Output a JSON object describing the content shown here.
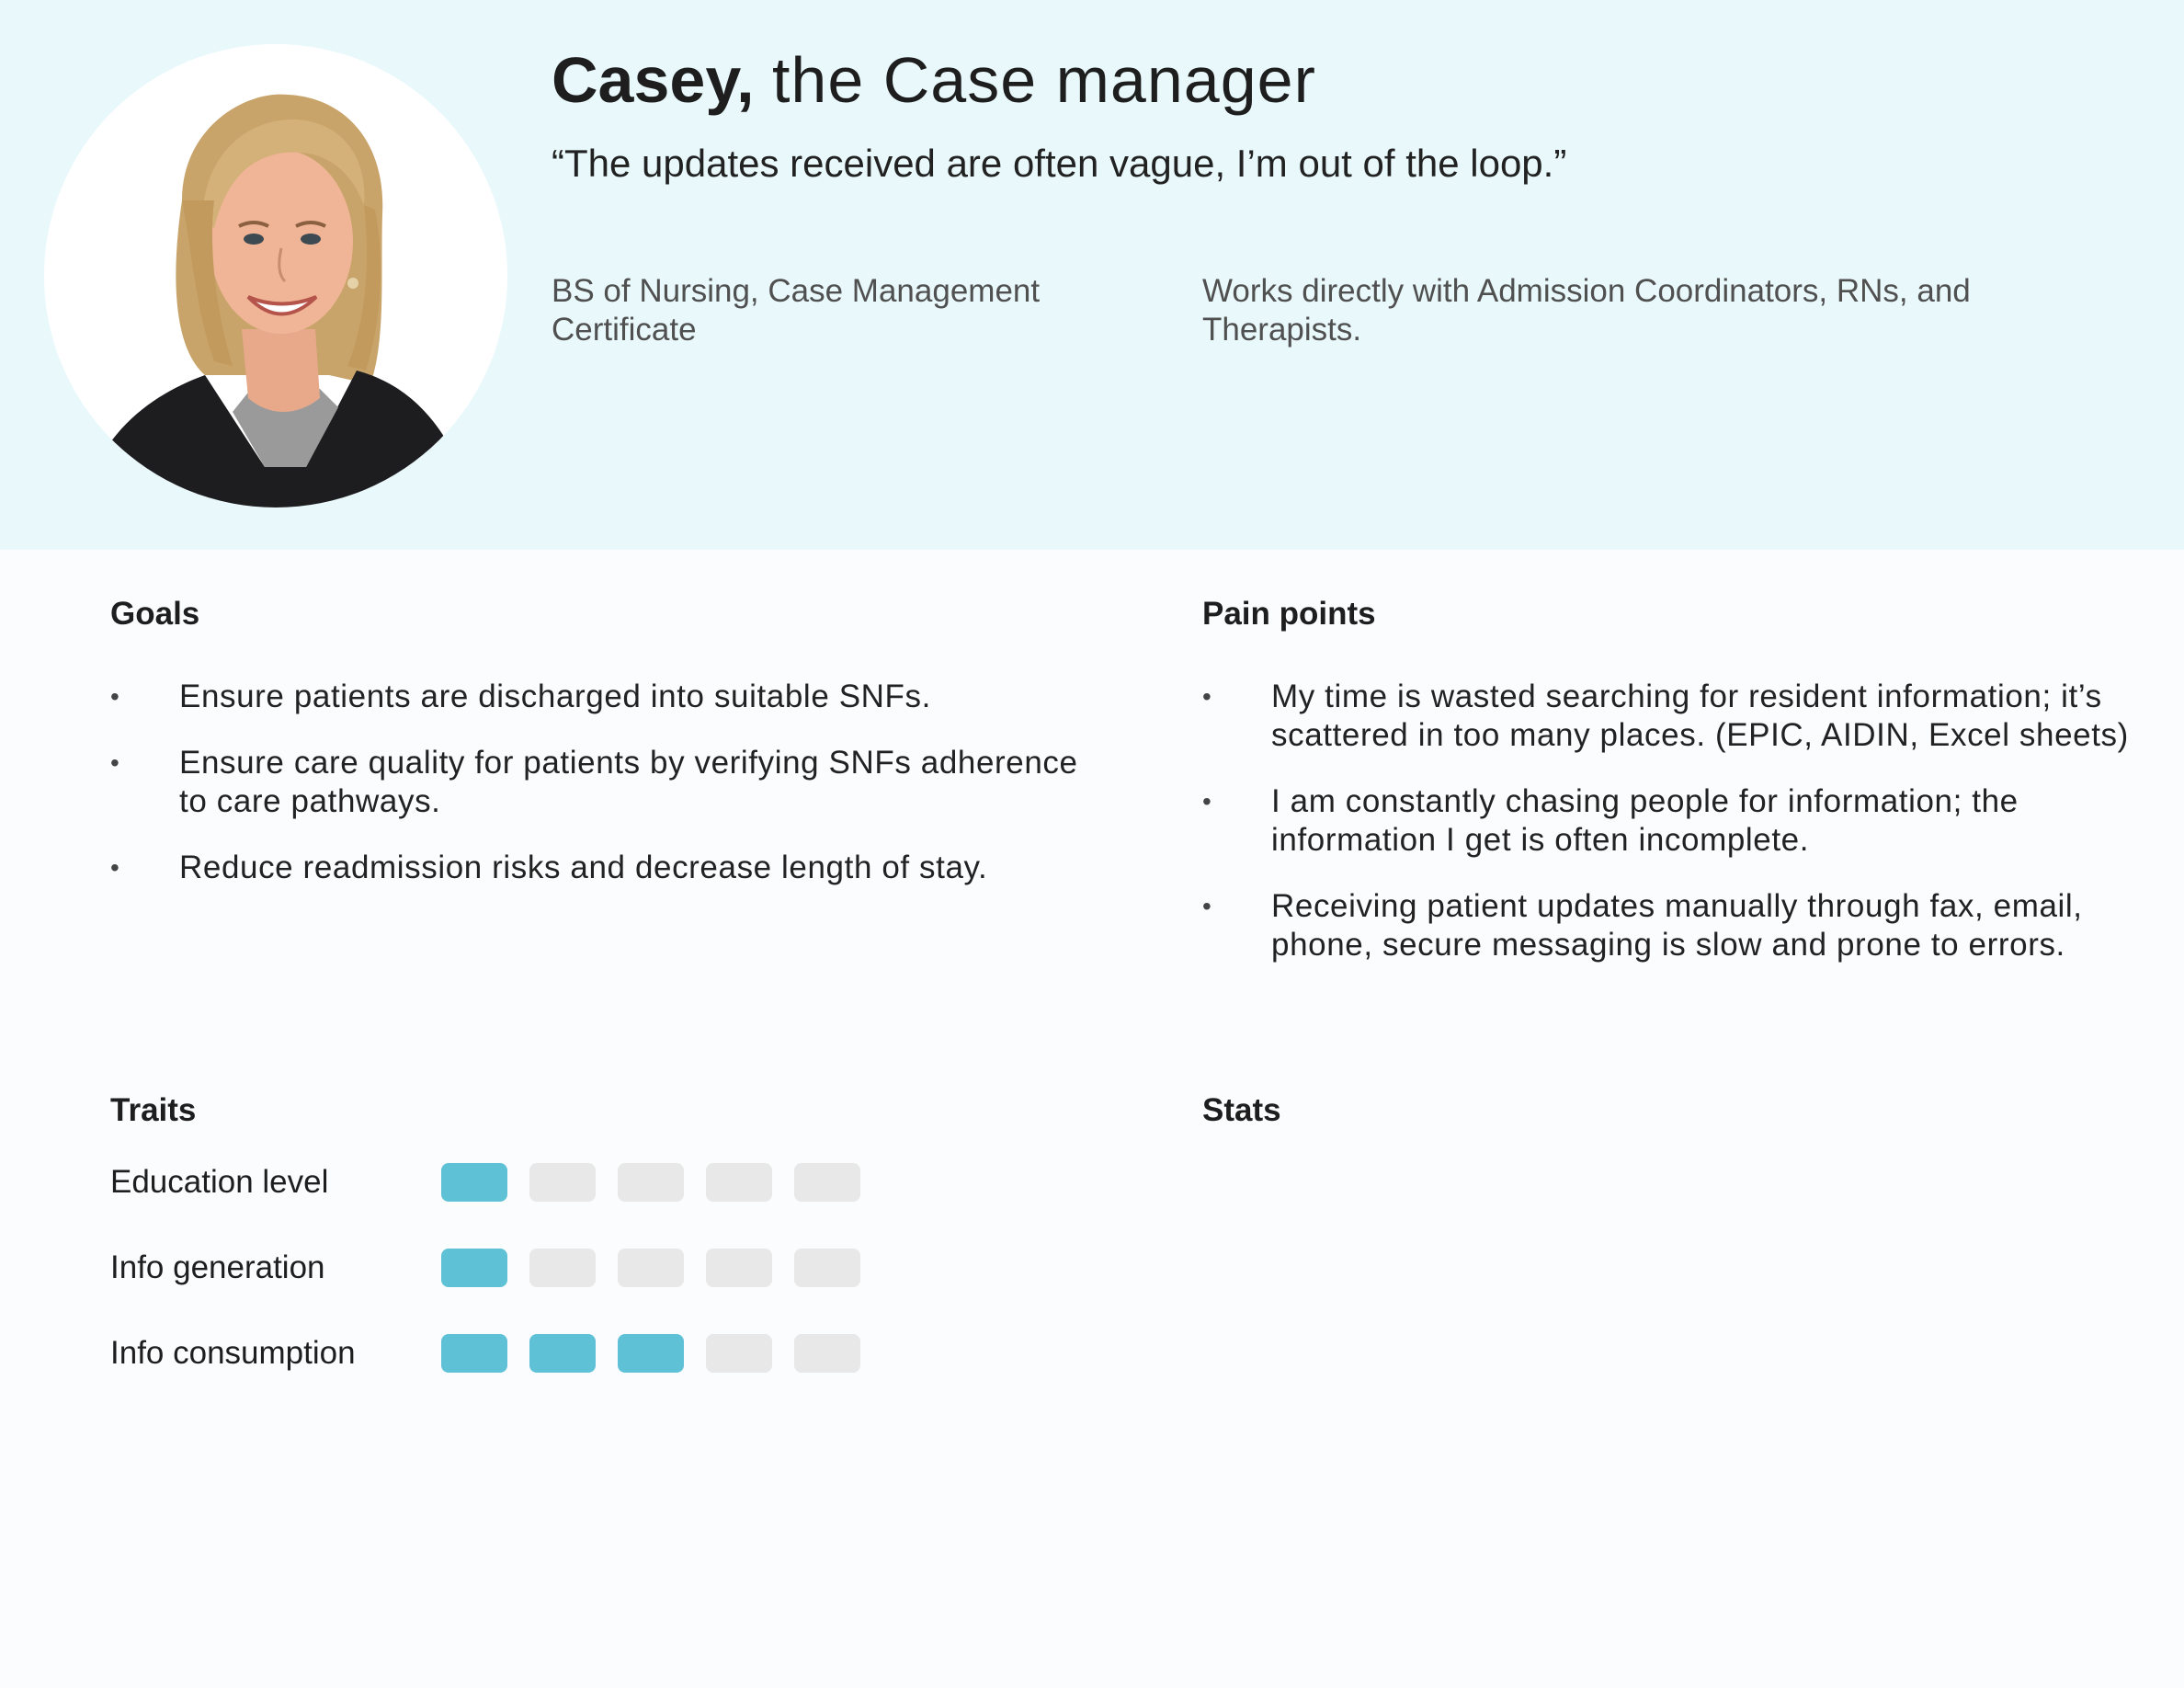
{
  "persona": {
    "name": "Casey,",
    "role": "the Case manager",
    "quote": "“The updates received are often vague, I’m out of the loop.”",
    "education": "BS of Nursing, Case Management Certificate",
    "works_with": "Works directly with Admission Coordinators, RNs, and Therapists."
  },
  "goals": {
    "title": "Goals",
    "items": [
      "Ensure patients are discharged into suitable SNFs.",
      "Ensure care quality for patients by verifying SNFs adherence to care pathways.",
      "Reduce readmission risks and decrease length of stay."
    ]
  },
  "pain_points": {
    "title": "Pain points",
    "items": [
      "My time is wasted searching for resident information; it’s scattered in too many places. (EPIC, AIDIN, Excel sheets)",
      "I am constantly chasing people for information; the information I get is often incomplete.",
      "Receiving patient updates manually through fax, email, phone, secure messaging is slow and prone to errors."
    ]
  },
  "traits": {
    "title": "Traits",
    "scale_max": 5,
    "items": [
      {
        "label": "Education level",
        "level": 1
      },
      {
        "label": "Info generation",
        "level": 1
      },
      {
        "label": "Info consumption",
        "level": 3
      }
    ]
  },
  "stats": {
    "title": "Stats"
  },
  "colors": {
    "header_bg": "#e8f8fb",
    "accent": "#5fc1d6",
    "inactive": "#e8e8e8",
    "page_bg": "#fafcfe"
  },
  "bullet_glyph": "•"
}
